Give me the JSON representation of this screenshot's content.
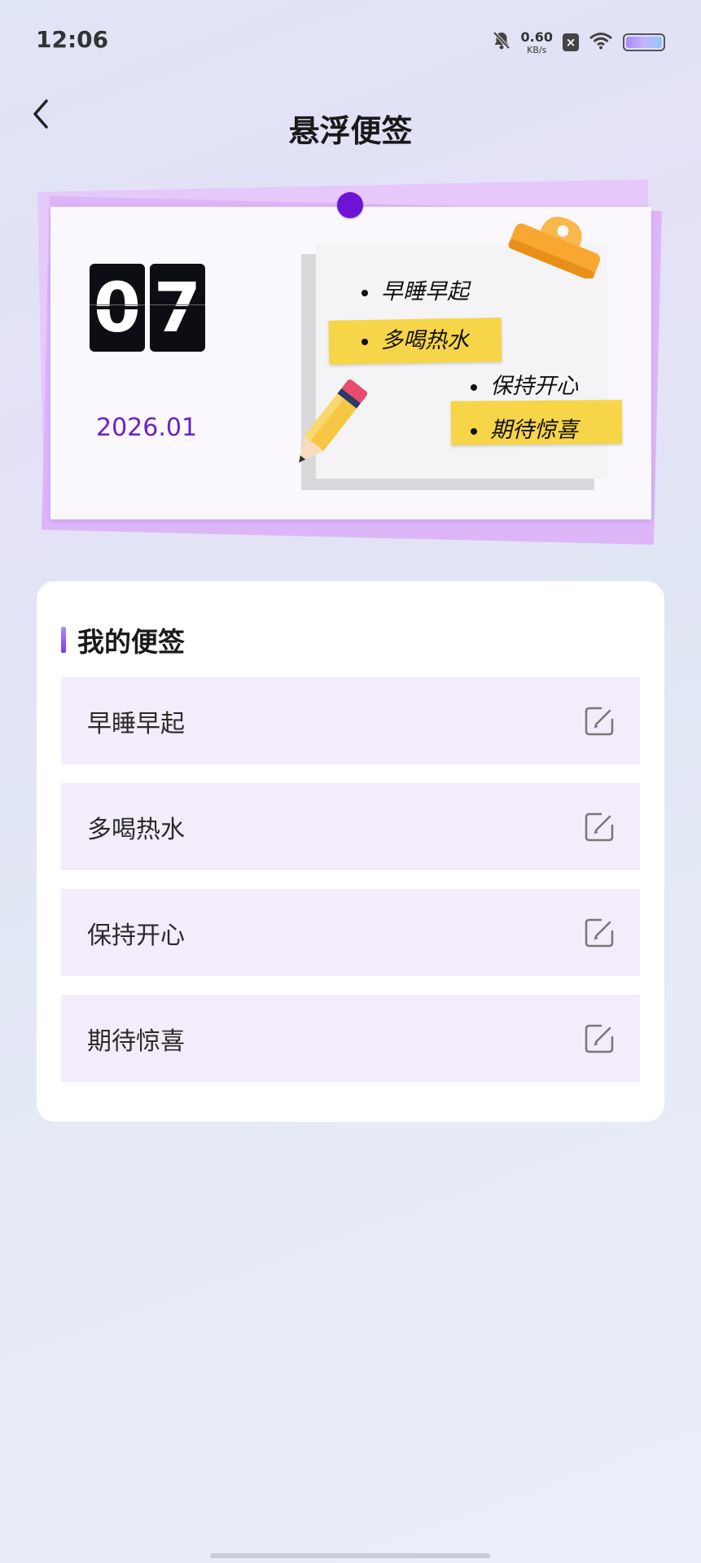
{
  "status_bar": {
    "time": "12:06",
    "net_speed_value": "0.60",
    "net_speed_unit": "KB/s",
    "icons": [
      "bell-muted-icon",
      "sim-off-icon",
      "wifi-icon",
      "battery-icon"
    ]
  },
  "header": {
    "title": "悬浮便签",
    "back_icon": "chevron-left-icon"
  },
  "hero": {
    "day_digits": [
      "0",
      "7"
    ],
    "year_month": "2026.01",
    "illustration_notes": [
      "早睡早起",
      "多喝热水",
      "保持开心",
      "期待惊喜"
    ],
    "colors": {
      "pin": "#6d13d6",
      "date": "#6b21c8",
      "tape": "#f6d548",
      "clip": "#f8a830"
    }
  },
  "notes_section": {
    "title": "我的便签",
    "items": [
      {
        "label": "早睡早起",
        "action_icon": "edit-icon"
      },
      {
        "label": "多喝热水",
        "action_icon": "edit-icon"
      },
      {
        "label": "保持开心",
        "action_icon": "edit-icon"
      },
      {
        "label": "期待惊喜",
        "action_icon": "edit-icon"
      }
    ],
    "colors": {
      "row_bg": "#f3ecfb",
      "accent": "#7c3aed"
    }
  }
}
